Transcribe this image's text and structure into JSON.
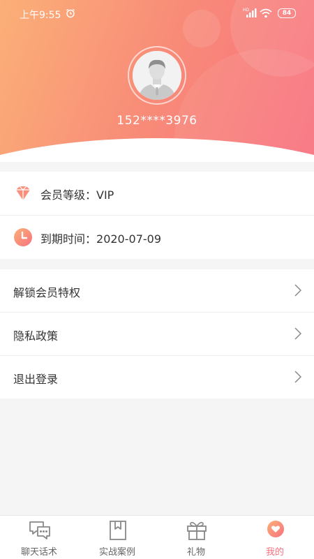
{
  "status_bar": {
    "time": "上午9:55",
    "battery": "84"
  },
  "profile": {
    "phone": "152****3976"
  },
  "membership": {
    "level_label": "会员等级：",
    "level_value": "VIP",
    "expiry_label": "到期时间：",
    "expiry_value": "2020-07-09"
  },
  "menu": {
    "items": [
      {
        "label": "解锁会员特权"
      },
      {
        "label": "隐私政策"
      },
      {
        "label": "退出登录"
      }
    ]
  },
  "tabbar": {
    "tabs": [
      {
        "label": "聊天话术",
        "icon": "chat-icon"
      },
      {
        "label": "实战案例",
        "icon": "bookmark-icon"
      },
      {
        "label": "礼物",
        "icon": "gift-icon"
      },
      {
        "label": "我的",
        "icon": "profile-heart-icon",
        "active": true
      }
    ]
  },
  "colors": {
    "gradient_start": "#fbb077",
    "gradient_end": "#f8717f",
    "accent": "#f8717f",
    "background": "#f5f5f5"
  }
}
